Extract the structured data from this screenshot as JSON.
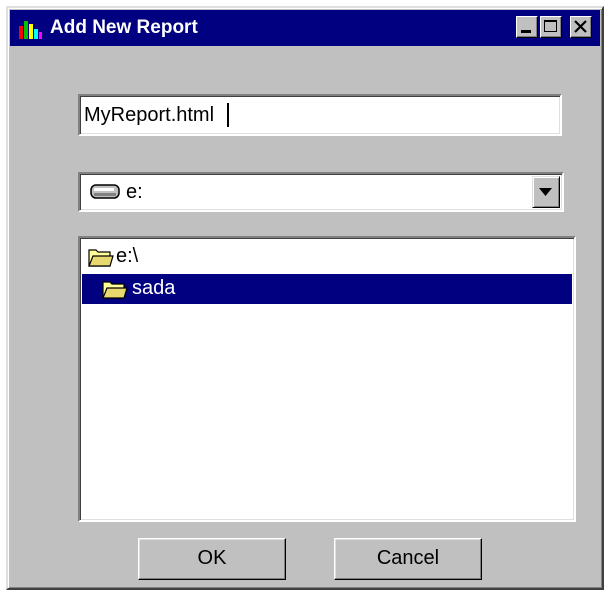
{
  "window": {
    "title": "Add New Report"
  },
  "titlebar": {
    "icons": {
      "app": "bar-chart-icon",
      "minimize": "minimize-icon",
      "maximize": "maximize-icon",
      "close": "close-icon"
    }
  },
  "report_name": {
    "value": "MyReport.html"
  },
  "drive": {
    "selected": "e:",
    "icon": "drive-icon",
    "dropdown_icon": "chevron-down-icon"
  },
  "folders": {
    "items": [
      {
        "label": "e:\\",
        "icon": "open-folder-icon",
        "selected": false
      },
      {
        "label": "sada",
        "icon": "open-folder-icon",
        "selected": true
      }
    ]
  },
  "buttons": {
    "ok": "OK",
    "cancel": "Cancel"
  },
  "colors": {
    "titlebar": "#000080",
    "selection": "#000080",
    "face": "#c0c0c0",
    "field": "#ffffff"
  }
}
